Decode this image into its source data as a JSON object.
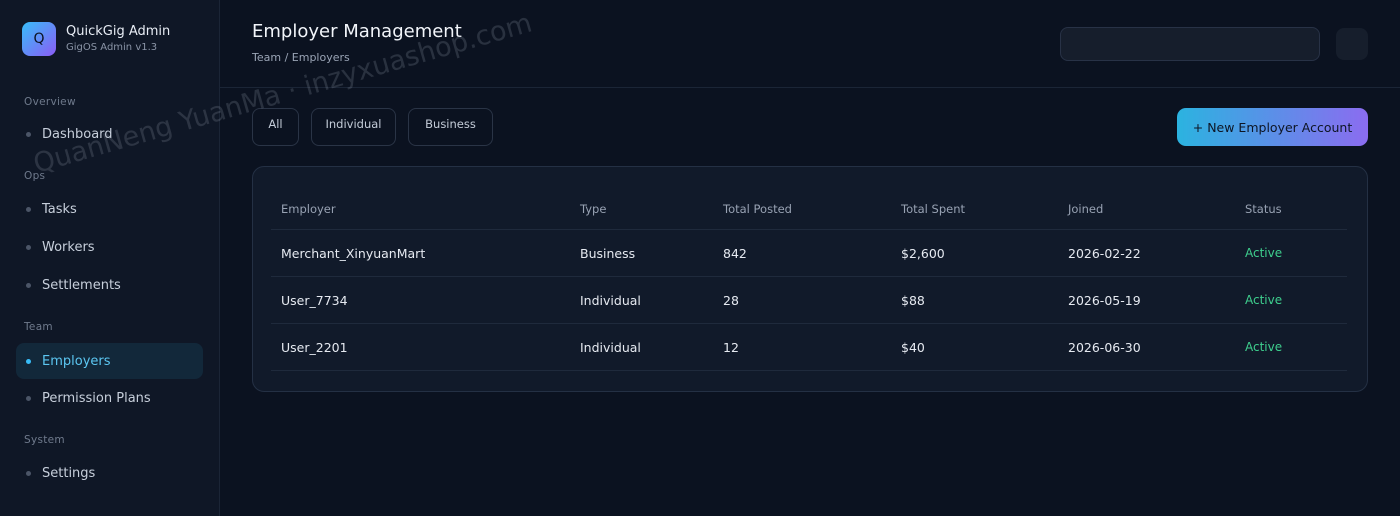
{
  "brand": {
    "logo_letter": "Q",
    "name": "QuickGig Admin",
    "subtitle": "GigOS Admin v1.3"
  },
  "sidebar": {
    "sections": [
      {
        "label": "Overview",
        "items": [
          {
            "label": "Dashboard",
            "icon": "dot-icon"
          }
        ]
      },
      {
        "label": "Ops",
        "items": [
          {
            "label": "Tasks",
            "icon": "dot-icon"
          },
          {
            "label": "Workers",
            "icon": "dot-icon"
          },
          {
            "label": "Settlements",
            "icon": "dot-icon"
          }
        ]
      },
      {
        "label": "Team",
        "items": [
          {
            "label": "Employers",
            "icon": "dot-icon",
            "active": true
          },
          {
            "label": "Permission Plans",
            "icon": "dot-icon"
          }
        ]
      },
      {
        "label": "System",
        "items": [
          {
            "label": "Settings",
            "icon": "dot-icon"
          }
        ]
      }
    ]
  },
  "header": {
    "title": "Employer Management",
    "breadcrumb": "Team / Employers"
  },
  "search": {
    "value": "",
    "placeholder": ""
  },
  "filters": [
    "All",
    "Individual",
    "Business"
  ],
  "actions": {
    "new_employer": "+ New Employer Account"
  },
  "table": {
    "columns": [
      "Employer",
      "Type",
      "Total Posted",
      "Total Spent",
      "Joined",
      "Status"
    ],
    "rows": [
      [
        "Merchant_XinyuanMart",
        "Business",
        "842",
        "$2,600",
        "2026-02-22",
        "Active"
      ],
      [
        "User_7734",
        "Individual",
        "28",
        "$88",
        "2026-05-19",
        "Active"
      ],
      [
        "User_2201",
        "Individual",
        "12",
        "$40",
        "2026-06-30",
        "Active"
      ]
    ]
  },
  "watermark": "QuanNeng YuanMa · inzyxuashop.com",
  "colors": {
    "accent": "#38bdf8",
    "accent_2": "#8b5cf6",
    "status_active": "#3ecf8e",
    "background": "#0b1220"
  }
}
